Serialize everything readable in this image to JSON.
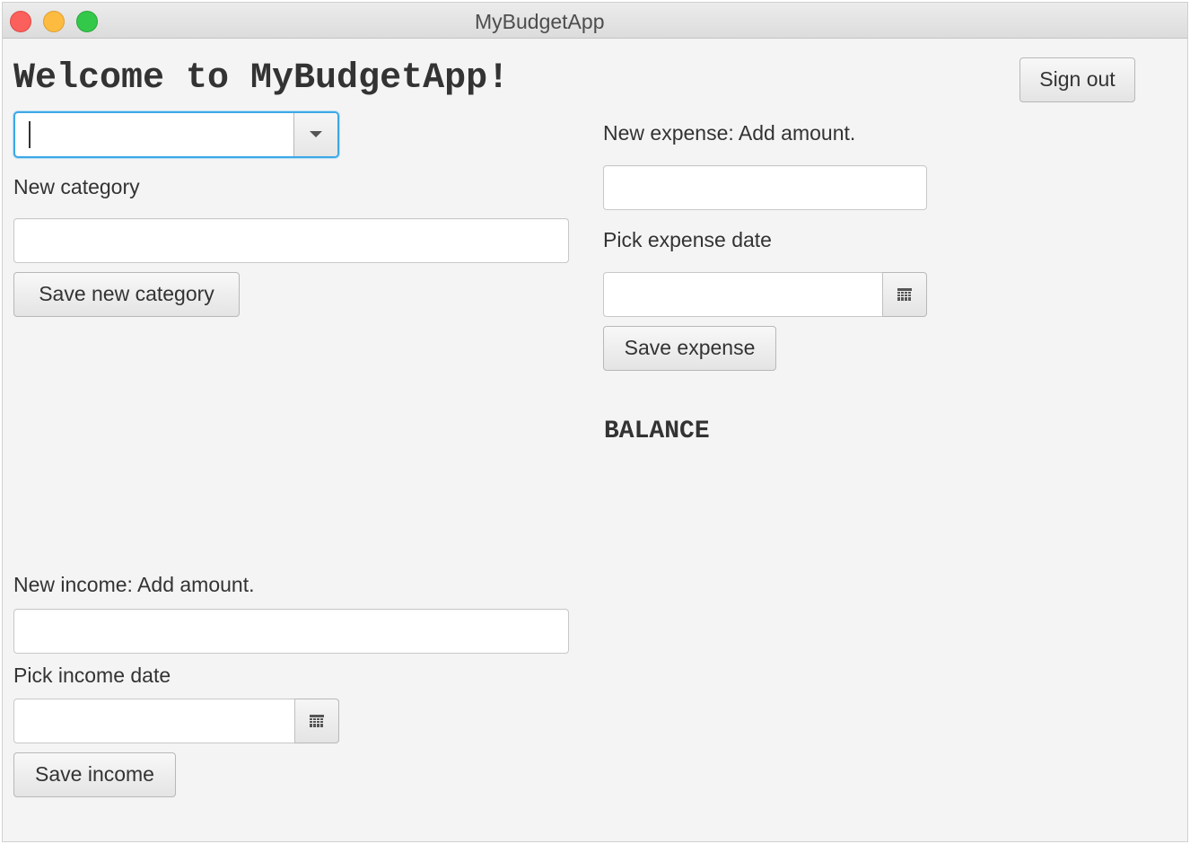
{
  "window": {
    "title": "MyBudgetApp"
  },
  "header": {
    "welcome": "Welcome to MyBudgetApp!",
    "sign_out": "Sign out"
  },
  "category": {
    "combo_value": "",
    "new_category_label": "New category",
    "new_category_value": "",
    "save_label": "Save new category"
  },
  "expense": {
    "amount_label": "New expense: Add amount.",
    "amount_value": "",
    "date_label": "Pick expense date",
    "date_value": "",
    "save_label": "Save expense"
  },
  "balance": {
    "label": "BALANCE"
  },
  "income": {
    "amount_label": "New income: Add amount.",
    "amount_value": "",
    "date_label": "Pick income date",
    "date_value": "",
    "save_label": "Save income"
  },
  "icons": {
    "close": "close-icon",
    "minimize": "minimize-icon",
    "maximize": "maximize-icon",
    "dropdown": "chevron-down-icon",
    "calendar": "calendar-icon"
  },
  "colors": {
    "window_bg": "#f4f4f4",
    "focus_ring": "#3da8e6",
    "close": "#fc605c",
    "minimize": "#fdbc40",
    "maximize": "#34c84a"
  }
}
